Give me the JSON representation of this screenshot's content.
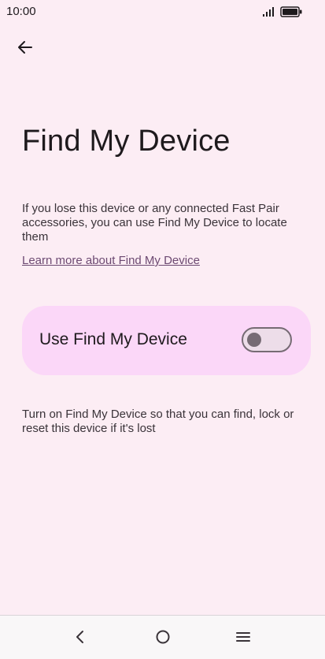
{
  "status_bar": {
    "time": "10:00",
    "signal_icon": "signal-icon",
    "battery_icon": "battery-icon"
  },
  "header": {
    "back_icon": "arrow-back-icon"
  },
  "main": {
    "title": "Find My Device",
    "description": "If you lose this device or any connected Fast Pair accessories, you can use Find My Device to locate them",
    "learn_more": "Learn more about Find My Device",
    "toggle": {
      "label": "Use Find My Device",
      "enabled": false
    },
    "footnote": "Turn on Find My Device so that you can find, lock or reset this device if it's lost"
  },
  "nav_bar": {
    "back_icon": "nav-back-icon",
    "home_icon": "nav-home-icon",
    "menu_icon": "nav-menu-icon"
  },
  "colors": {
    "background": "#fcedf4",
    "card": "#fbd7f8",
    "link": "#6d4a72",
    "switch_outline": "#766b74"
  }
}
